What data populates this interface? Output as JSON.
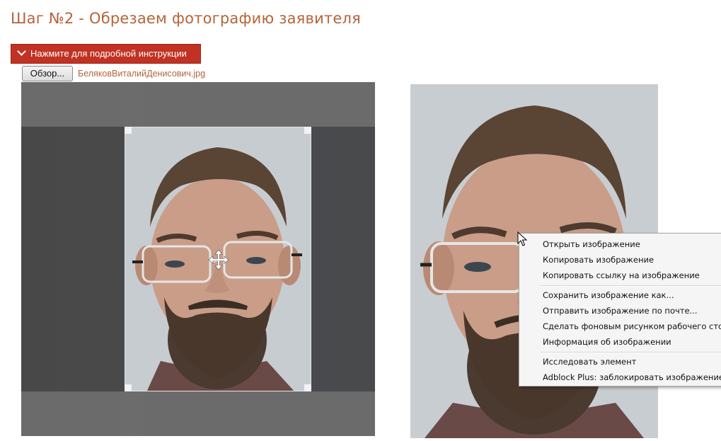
{
  "page": {
    "title": "Шаг №2 - Обрезаем фотографию заявителя",
    "instructions_button": "Нажмите для подробной инструкции",
    "browse_button": "Обзор...",
    "file_name": "БеляковВиталийДенисович.jpg"
  },
  "context_menu": {
    "items": [
      "Открыть изображение",
      "Копировать изображение",
      "Копировать ссылку на изображение",
      "Сохранить изображение как...",
      "Отправить изображение по почте...",
      "Сделать фоновым рисунком рабочего стола...",
      "Информация об изображении",
      "Исследовать элемент",
      "Adblock Plus: заблокировать изображение..."
    ]
  },
  "colors": {
    "title": "#b5643a",
    "button_red": "#c13223",
    "file_link": "#b5643a"
  },
  "icons": [
    "chevron-down-icon",
    "move-icon",
    "cursor-arrow-icon"
  ]
}
